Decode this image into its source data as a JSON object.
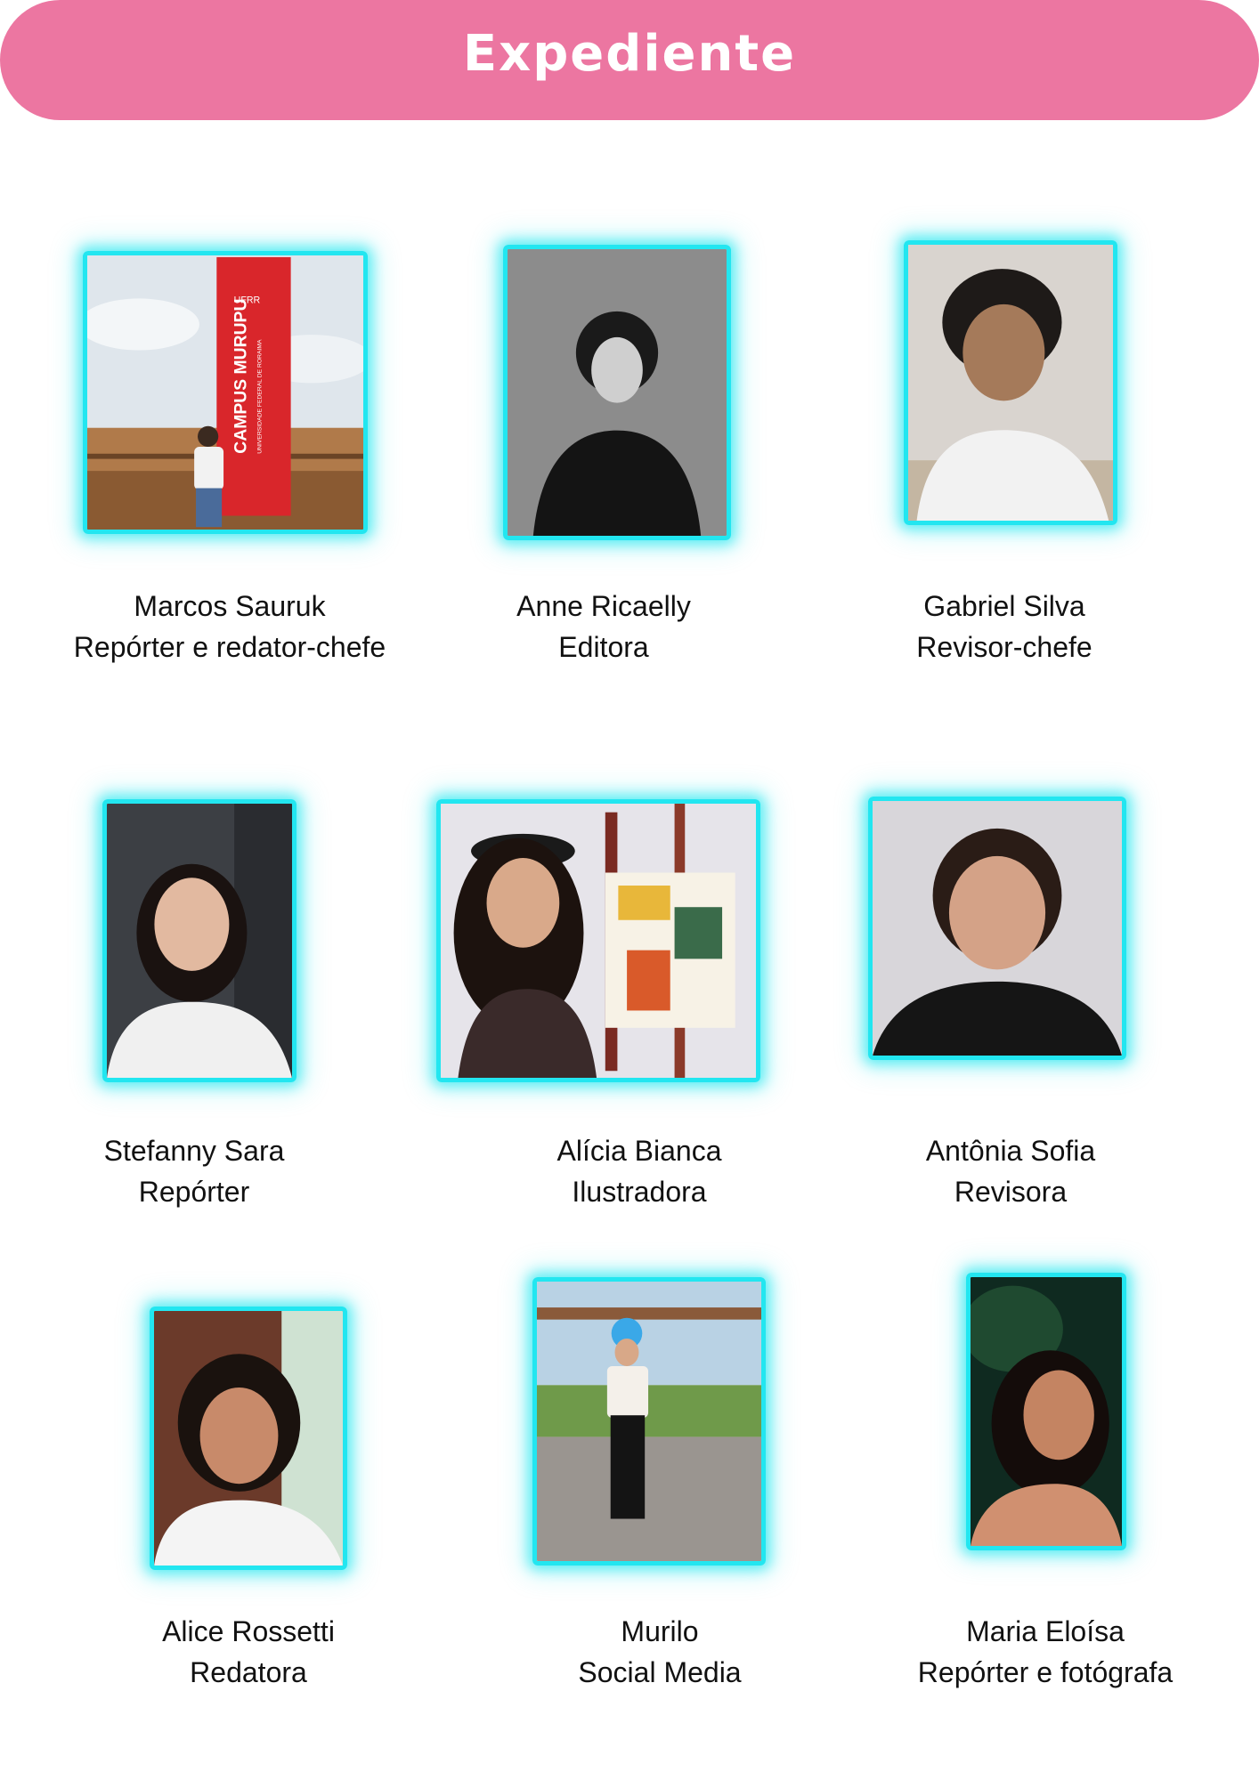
{
  "page": {
    "title": "Expediente",
    "banner_color": "#ec76a1",
    "glow_color": "#22e6f0"
  },
  "members": [
    {
      "name": "Marcos Sauruk",
      "role": "Repórter e redator-chefe",
      "photo_sign_top": "UFRR",
      "photo_sign_main": "CAMPUS MURUPU",
      "photo_sign_sub": "UNIVERSIDADE FEDERAL DE RORAIMA"
    },
    {
      "name": "Anne Ricaelly",
      "role": "Editora"
    },
    {
      "name": "Gabriel Silva",
      "role": "Revisor-chefe"
    },
    {
      "name": "Stefanny Sara",
      "role": "Repórter"
    },
    {
      "name": "Alícia Bianca",
      "role": "Ilustradora"
    },
    {
      "name": "Antônia Sofia",
      "role": "Revisora"
    },
    {
      "name": "Alice Rossetti",
      "role": "Redatora"
    },
    {
      "name": "Murilo",
      "role": "Social Media"
    },
    {
      "name": "Maria Eloísa",
      "role": "Repórter e fotógrafa"
    }
  ]
}
